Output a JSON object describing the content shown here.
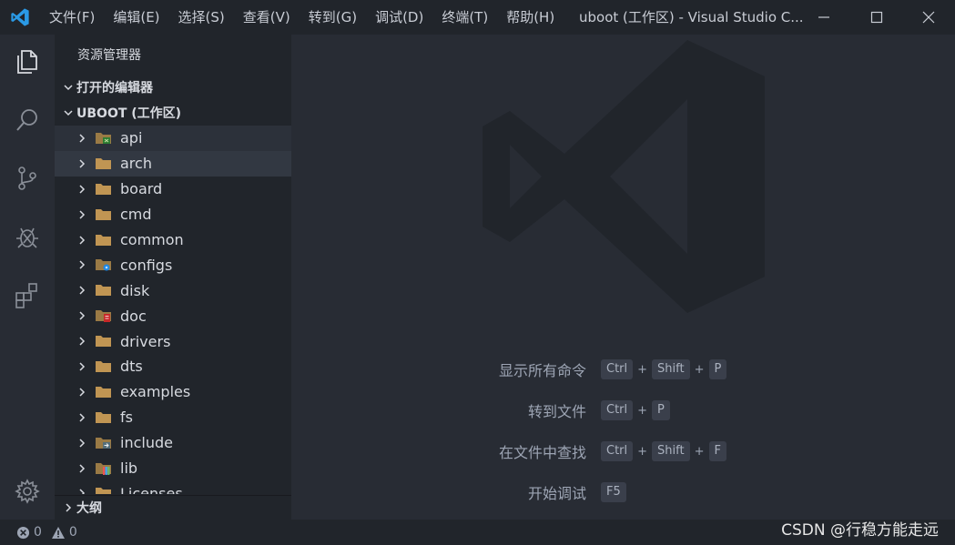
{
  "titlebar": {
    "menu": [
      "文件(F)",
      "编辑(E)",
      "选择(S)",
      "查看(V)",
      "转到(G)",
      "调试(D)",
      "终端(T)",
      "帮助(H)"
    ],
    "window_title": "uboot (工作区) - Visual Studio C..."
  },
  "sidebar": {
    "header": "资源管理器",
    "open_editors": "打开的编辑器",
    "workspace": "UBOOT (工作区)",
    "outline": "大纲",
    "items": [
      {
        "label": "api",
        "icon": "folder-api-icon",
        "color": "#8bc34a"
      },
      {
        "label": "arch",
        "icon": "folder-icon",
        "color": "#c09553"
      },
      {
        "label": "board",
        "icon": "folder-icon",
        "color": "#c09553"
      },
      {
        "label": "cmd",
        "icon": "folder-icon",
        "color": "#c09553"
      },
      {
        "label": "common",
        "icon": "folder-icon",
        "color": "#c09553"
      },
      {
        "label": "configs",
        "icon": "folder-config-icon",
        "color": "#42a5f5"
      },
      {
        "label": "disk",
        "icon": "folder-icon",
        "color": "#c09553"
      },
      {
        "label": "doc",
        "icon": "folder-doc-icon",
        "color": "#e57373"
      },
      {
        "label": "drivers",
        "icon": "folder-icon",
        "color": "#c09553"
      },
      {
        "label": "dts",
        "icon": "folder-icon",
        "color": "#c09553"
      },
      {
        "label": "examples",
        "icon": "folder-icon",
        "color": "#c09553"
      },
      {
        "label": "fs",
        "icon": "folder-icon",
        "color": "#c09553"
      },
      {
        "label": "include",
        "icon": "folder-include-icon",
        "color": "#90a4ae"
      },
      {
        "label": "lib",
        "icon": "folder-lib-icon",
        "color": "#ba68c8"
      },
      {
        "label": "Licenses",
        "icon": "folder-icon",
        "color": "#c09553"
      }
    ]
  },
  "editor": {
    "shortcuts": [
      {
        "label": "显示所有命令",
        "keys": [
          "Ctrl",
          "Shift",
          "P"
        ]
      },
      {
        "label": "转到文件",
        "keys": [
          "Ctrl",
          "P"
        ]
      },
      {
        "label": "在文件中查找",
        "keys": [
          "Ctrl",
          "Shift",
          "F"
        ]
      },
      {
        "label": "开始调试",
        "keys": [
          "F5"
        ]
      }
    ]
  },
  "statusbar": {
    "errors": "0",
    "warnings": "0",
    "watermark": "CSDN @行稳方能走远"
  },
  "colors": {
    "accent": "#0078d4",
    "folder": "#c09553"
  }
}
